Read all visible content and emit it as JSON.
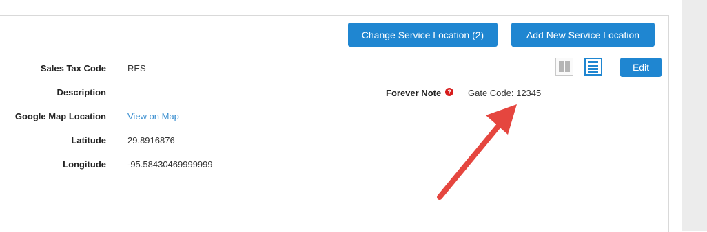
{
  "toolbar": {
    "change_location_label": "Change Service Location (2)",
    "add_location_label": "Add New Service Location",
    "edit_label": "Edit"
  },
  "details": [
    {
      "label": "Sales Tax Code",
      "value": "RES"
    },
    {
      "label": "Description",
      "value": ""
    },
    {
      "label": "Google Map Location",
      "value": "View on Map"
    },
    {
      "label": "Latitude",
      "value": "29.8916876"
    },
    {
      "label": "Longitude",
      "value": "-95.58430469999999"
    }
  ],
  "forever_note": {
    "label": "Forever Note",
    "value": "Gate Code: 12345",
    "help_icon": "question-circle-icon"
  },
  "view_toggles": {
    "columns_icon": "two-column-view-icon",
    "list_icon": "list-view-icon",
    "active": "list"
  },
  "annotation": {
    "icon": "red-arrow",
    "color": "#e5463f"
  },
  "colors": {
    "accent": "#1f86d1",
    "link": "#3b8fd0",
    "help": "#d71c1c"
  }
}
